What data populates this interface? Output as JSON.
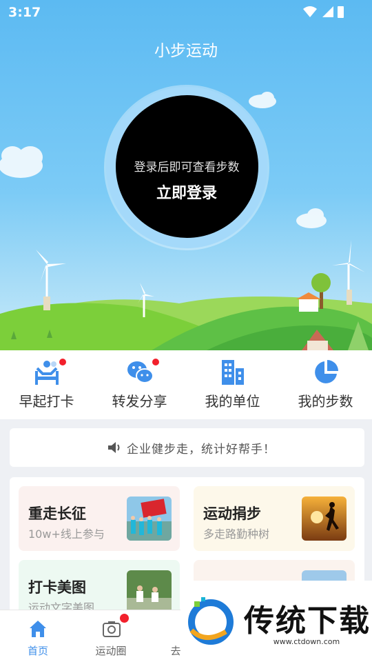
{
  "status_bar": {
    "time": "3:17"
  },
  "app": {
    "title": "小步运动"
  },
  "login": {
    "hint": "登录后即可查看步数",
    "button": "立即登录"
  },
  "quick_actions": [
    {
      "label": "早起打卡",
      "icon": "morning-checkin-icon",
      "badge": true
    },
    {
      "label": "转发分享",
      "icon": "wechat-share-icon",
      "badge": true
    },
    {
      "label": "我的单位",
      "icon": "building-icon",
      "badge": false
    },
    {
      "label": "我的步数",
      "icon": "pie-chart-icon",
      "badge": false
    }
  ],
  "notice": {
    "text": "企业健步走，统计好帮手！"
  },
  "cards": [
    {
      "title": "重走长征",
      "subtitle": "10w+线上参与"
    },
    {
      "title": "运动捐步",
      "subtitle": "多走路勤种树"
    },
    {
      "title": "打卡美图",
      "subtitle": "运动文字美图"
    },
    {
      "title": "",
      "subtitle": ""
    }
  ],
  "tabs": [
    {
      "label": "首页",
      "active": true
    },
    {
      "label": "运动圈",
      "active": false,
      "badge": true
    },
    {
      "label": "去",
      "active": false
    }
  ],
  "watermark": {
    "brand": "传统下载",
    "url": "www.ctdown.com"
  },
  "colors": {
    "accent": "#3f8fea",
    "badge": "#f2202c",
    "sky": "#5cbaf2",
    "grass": "#7ccf3a"
  }
}
